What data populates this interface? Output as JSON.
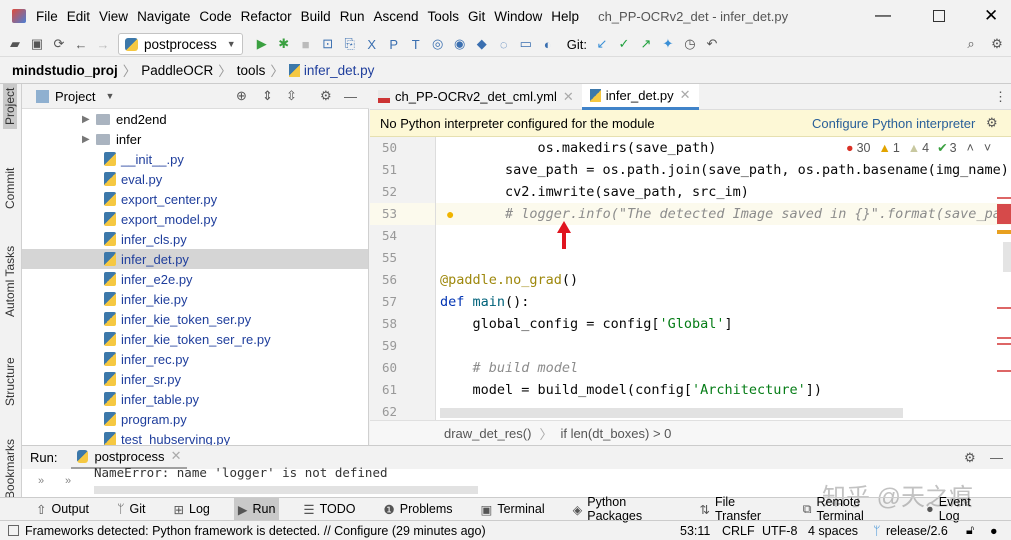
{
  "menu": [
    "File",
    "Edit",
    "View",
    "Navigate",
    "Code",
    "Refactor",
    "Build",
    "Run",
    "Ascend",
    "Tools",
    "Git",
    "Window",
    "Help"
  ],
  "window_title": "ch_PP-OCRv2_det - infer_det.py",
  "toolbar": {
    "run_config": "postprocess",
    "git_label": "Git:"
  },
  "breadcrumb": [
    "mindstudio_proj",
    "PaddleOCR",
    "tools",
    "infer_det.py"
  ],
  "left_strip": [
    "Project",
    "Commit",
    "Automl Tasks",
    "Structure",
    "Bookmarks"
  ],
  "project_panel": {
    "title": "Project"
  },
  "tree": [
    {
      "label": "end2end",
      "type": "folder"
    },
    {
      "label": "infer",
      "type": "folder"
    },
    {
      "label": "__init__.py",
      "type": "file"
    },
    {
      "label": "eval.py",
      "type": "file"
    },
    {
      "label": "export_center.py",
      "type": "file"
    },
    {
      "label": "export_model.py",
      "type": "file"
    },
    {
      "label": "infer_cls.py",
      "type": "file"
    },
    {
      "label": "infer_det.py",
      "type": "file",
      "selected": true
    },
    {
      "label": "infer_e2e.py",
      "type": "file"
    },
    {
      "label": "infer_kie.py",
      "type": "file"
    },
    {
      "label": "infer_kie_token_ser.py",
      "type": "file"
    },
    {
      "label": "infer_kie_token_ser_re.py",
      "type": "file"
    },
    {
      "label": "infer_rec.py",
      "type": "file"
    },
    {
      "label": "infer_sr.py",
      "type": "file"
    },
    {
      "label": "infer_table.py",
      "type": "file"
    },
    {
      "label": "program.py",
      "type": "file"
    },
    {
      "label": "test_hubserving.py",
      "type": "file"
    }
  ],
  "tabs": [
    {
      "label": "ch_PP-OCRv2_det_cml.yml",
      "active": false
    },
    {
      "label": "infer_det.py",
      "active": true
    }
  ],
  "banner": {
    "text": "No Python interpreter configured for the module",
    "link": "Configure Python interpreter"
  },
  "inspections": {
    "errors": "30",
    "warnings": "1",
    "weak_warnings": "4",
    "typos": "3"
  },
  "code_lines": [
    "50",
    "51",
    "52",
    "53",
    "54",
    "55",
    "56",
    "57",
    "58",
    "59",
    "60",
    "61",
    "62"
  ],
  "editor_breadcrumb": [
    "draw_det_res()",
    "if len(dt_boxes) > 0"
  ],
  "run": {
    "label": "Run:",
    "config": "postprocess",
    "output": "NameError: name 'logger' is not defined"
  },
  "tool_windows": [
    "Output",
    "Git",
    "Log",
    "Run",
    "TODO",
    "Problems",
    "Terminal",
    "Python Packages",
    "File Transfer",
    "Remote Terminal",
    "Event Log"
  ],
  "watermark": "知乎 @天之痕",
  "status": {
    "message": "Frameworks detected: Python framework is detected. // Configure (29 minutes ago)",
    "position": "53:11",
    "line_sep": "CRLF",
    "encoding": "UTF-8",
    "indent": "4 spaces",
    "branch": "release/2.6"
  },
  "colors": {
    "accent": "#4083c9",
    "banner_bg": "#fdf8d6",
    "error": "#d93025",
    "arrow": "#e0141e"
  }
}
